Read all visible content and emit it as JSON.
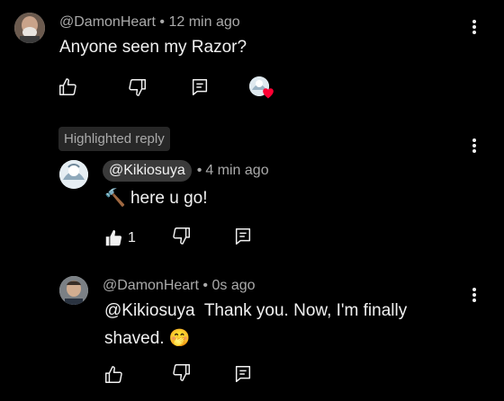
{
  "comments": [
    {
      "handle": "@DamonHeart",
      "separator": "•",
      "time": "12 min ago",
      "text": "Anyone seen my Razor?"
    }
  ],
  "highlight": {
    "label": "Highlighted reply"
  },
  "replies": [
    {
      "handle": "@Kikiosuya",
      "separator": "•",
      "time": "4 min ago",
      "text": "here u go!",
      "emoji": "🔨",
      "like_count": "1"
    },
    {
      "handle": "@DamonHeart",
      "separator": "•",
      "time": "0s ago",
      "mention": "@Kikiosuya",
      "text_line1": "Thank you. Now, I'm finally",
      "text_line2": "shaved.",
      "emoji": "🤭"
    }
  ],
  "colors": {
    "background": "#000000",
    "text_primary": "#f1f1f1",
    "text_secondary": "#aaaaaa",
    "heart": "#ff0033",
    "chip_bg": "#272727"
  },
  "icons": [
    "like-icon",
    "dislike-icon",
    "reply-icon",
    "creator-heart-icon",
    "more-vert-icon"
  ]
}
